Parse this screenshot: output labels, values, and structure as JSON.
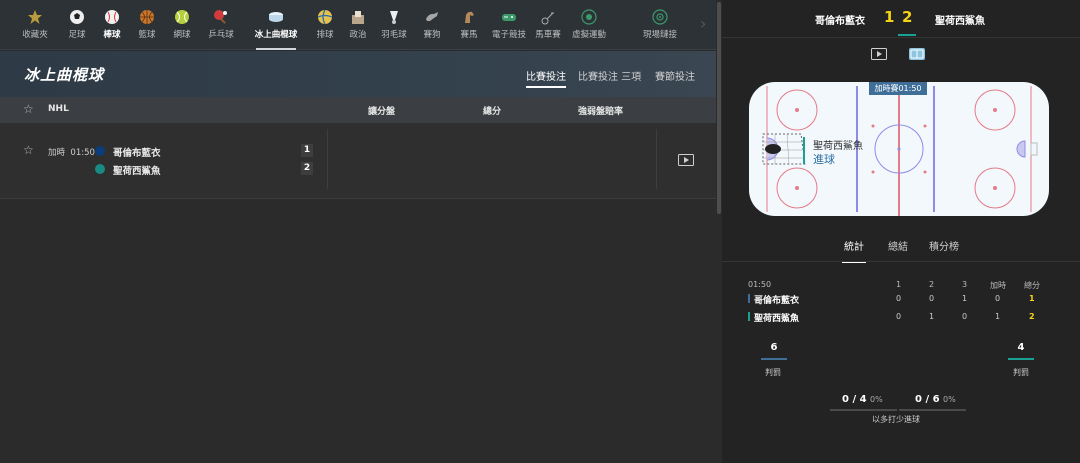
{
  "sports_nav": {
    "items": [
      {
        "label": "收藏夾",
        "icon": "star-icon"
      },
      {
        "label": "足球",
        "icon": "soccer-ball-icon"
      },
      {
        "label": "棒球",
        "icon": "baseball-icon"
      },
      {
        "label": "籃球",
        "icon": "basketball-icon"
      },
      {
        "label": "網球",
        "icon": "tennis-ball-icon"
      },
      {
        "label": "乒乓球",
        "icon": "ping-pong-icon"
      },
      {
        "label": "冰上曲棍球",
        "icon": "ice-hockey-puck-icon"
      },
      {
        "label": "排球",
        "icon": "volleyball-icon"
      },
      {
        "label": "政治",
        "icon": "ballot-box-icon"
      },
      {
        "label": "羽毛球",
        "icon": "shuttlecock-icon"
      },
      {
        "label": "賽狗",
        "icon": "greyhound-icon"
      },
      {
        "label": "賽馬",
        "icon": "horse-icon"
      },
      {
        "label": "電子競技",
        "icon": "gamepad-icon"
      },
      {
        "label": "馬車賽",
        "icon": "harness-racing-icon"
      },
      {
        "label": "虛擬運動",
        "icon": "virtual-sports-icon"
      },
      {
        "label": "現場鏈接",
        "icon": "live-link-icon"
      }
    ],
    "active_label": "冰上曲棍球",
    "bold_label": "棒球"
  },
  "page": {
    "title": "冰上曲棍球",
    "tabs": [
      "比賽投注",
      "比賽投注 三項",
      "賽節投注"
    ],
    "active_tab": "比賽投注"
  },
  "league": {
    "name": "NHL",
    "col_handicap": "讓分盤",
    "col_total": "總分",
    "col_odds": "強弱盤賠率"
  },
  "match": {
    "status": "加時",
    "time": "01:50",
    "home": {
      "name": "哥倫布藍衣",
      "score": "1",
      "color": "#0b3d7a"
    },
    "away": {
      "name": "聖荷西鯊魚",
      "score": "2",
      "color": "#1a8a85"
    }
  },
  "scoreboard": {
    "home_team": "哥倫布藍衣",
    "away_team": "聖荷西鯊魚",
    "home_score": "1",
    "away_score": "2",
    "score_color": "#f5d418"
  },
  "rink": {
    "badge": "加時賽01:50",
    "team": "聖荷西鯊魚",
    "event": "進球"
  },
  "stat_tabs": [
    "統計",
    "總結",
    "積分榜"
  ],
  "active_stat_tab": "統計",
  "stats_table": {
    "time": "01:50",
    "headers": [
      "1",
      "2",
      "3",
      "加時",
      "總分"
    ],
    "rows": [
      {
        "team": "哥倫布藍衣",
        "values": [
          "0",
          "0",
          "1",
          "0"
        ],
        "total": "1",
        "color": "#3f6e99"
      },
      {
        "team": "聖荷西鯊魚",
        "values": [
          "0",
          "1",
          "0",
          "1"
        ],
        "total": "2",
        "color": "#1aa092"
      }
    ]
  },
  "penalties": {
    "home": "6",
    "away": "4",
    "label": "判罰"
  },
  "powerplay": {
    "home_value": "0 / 4",
    "home_pct": "0%",
    "away_value": "0 / 6",
    "away_pct": "0%",
    "label": "以多打少進球"
  }
}
